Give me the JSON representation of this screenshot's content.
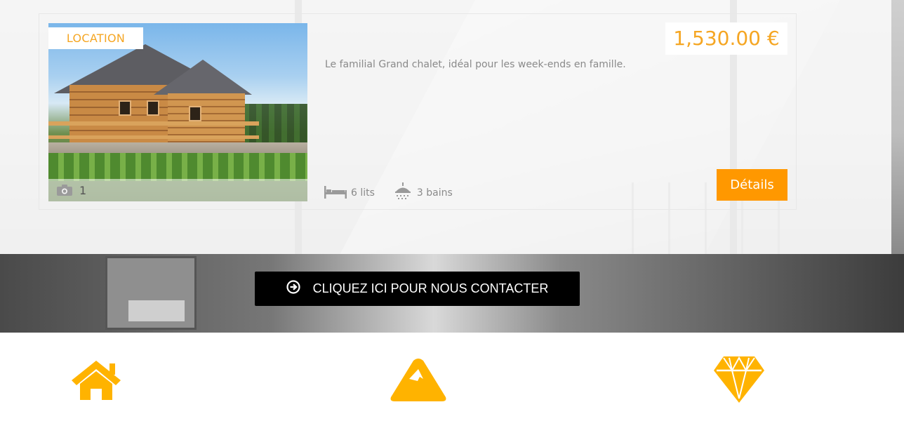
{
  "listing": {
    "badge": "LOCATION",
    "photo_count": "1",
    "price": "1,530.00 €",
    "description": "Le familial Grand chalet, idéal pour les week-ends en famille.",
    "beds": "6 lits",
    "baths": "3 bains",
    "details_label": "Détails"
  },
  "contact": {
    "label": "CLIQUEZ ICI POUR NOUS CONTACTER"
  },
  "icons": [
    "house-icon",
    "mountain-icon",
    "diamond-icon"
  ],
  "colors": {
    "accent": "#ff9800",
    "accent_text": "#f5a623",
    "icon": "#ffb300",
    "contact_bg": "#000000"
  }
}
